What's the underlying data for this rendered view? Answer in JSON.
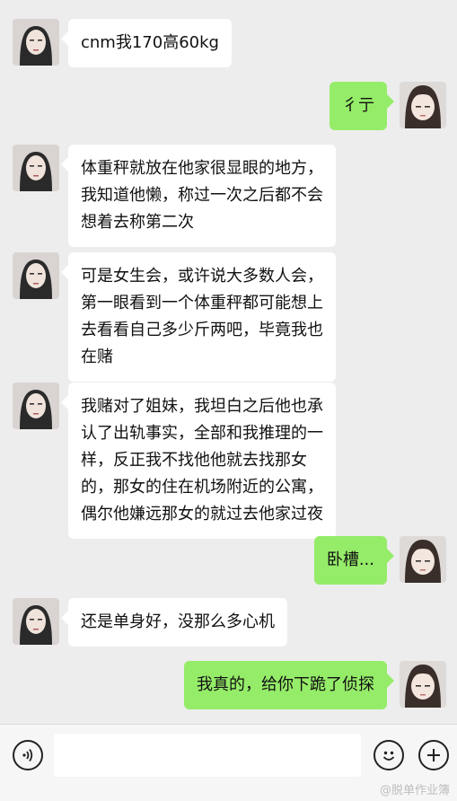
{
  "messages": [
    {
      "side": "left",
      "text": "cnm我170高60kg"
    },
    {
      "side": "right",
      "text": "彳亍"
    },
    {
      "side": "left",
      "text": "体重秤就放在他家很显眼的地方，\n我知道他懒，称过一次之后都不会\n想着去称第二次"
    },
    {
      "side": "left",
      "text": "可是女生会，或许说大多数人会，\n第一眼看到一个体重秤都可能想上\n去看看自己多少斤两吧，毕竟我也\n在赌"
    },
    {
      "side": "left",
      "text": "我赌对了姐妹，我坦白之后他也承\n认了出轨事实，全部和我推理的一\n样，反正我不找他他就去找那女\n的，那女的住在机场附近的公寓，\n偶尔他嫌远那女的就过去他家过夜"
    },
    {
      "side": "right",
      "text": "卧槽..."
    },
    {
      "side": "left",
      "text": "还是单身好，没那么多心机"
    },
    {
      "side": "right",
      "text": "我真的，给你下跪了侦探"
    }
  ],
  "watermark": "@脱单作业簿",
  "colors": {
    "background": "#ededed",
    "left_bubble": "#ffffff",
    "right_bubble": "#95ec69"
  },
  "icons": {
    "voice": "voice-icon",
    "emoji": "emoji-icon",
    "add": "plus-icon"
  }
}
